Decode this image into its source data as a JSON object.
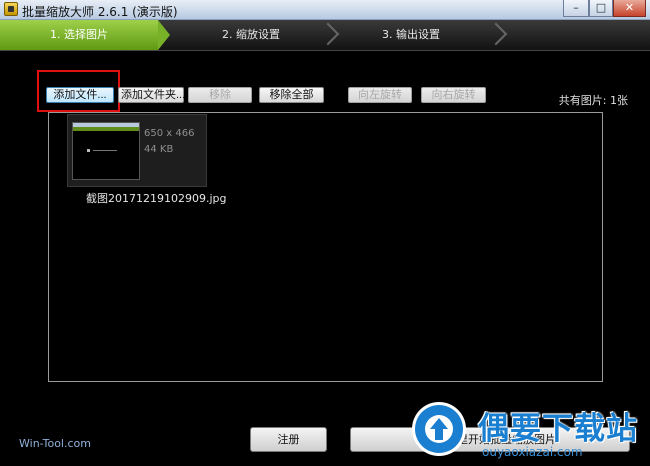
{
  "window": {
    "title": "批量缩放大师 2.6.1 (演示版)",
    "min_label": "–",
    "max_label": "□",
    "close_label": "✕"
  },
  "steps": [
    {
      "label": "1. 选择图片",
      "active": true
    },
    {
      "label": "2. 缩放设置",
      "active": false
    },
    {
      "label": "3. 输出设置",
      "active": false
    }
  ],
  "toolbar": {
    "add_file": "添加文件...",
    "add_folder": "添加文件夹...",
    "remove": "移除",
    "remove_all": "移除全部",
    "rotate_left": "向左旋转",
    "rotate_right": "向右旋转",
    "count": "共有图片: 1张"
  },
  "images": [
    {
      "dimensions": "650 x 466",
      "size": "44 KB",
      "filename": "截图20171219102909.jpg"
    }
  ],
  "footer": {
    "link": "Win-Tool.com",
    "register": "注册",
    "start": "点击这里开始批量缩放图片"
  },
  "watermark": {
    "title": "偶要下载站",
    "url": "ouyaoxiazai.com"
  },
  "colors": {
    "active_step": "#79b128",
    "highlight": "#e01010",
    "watermark": "#1a7fd1"
  }
}
